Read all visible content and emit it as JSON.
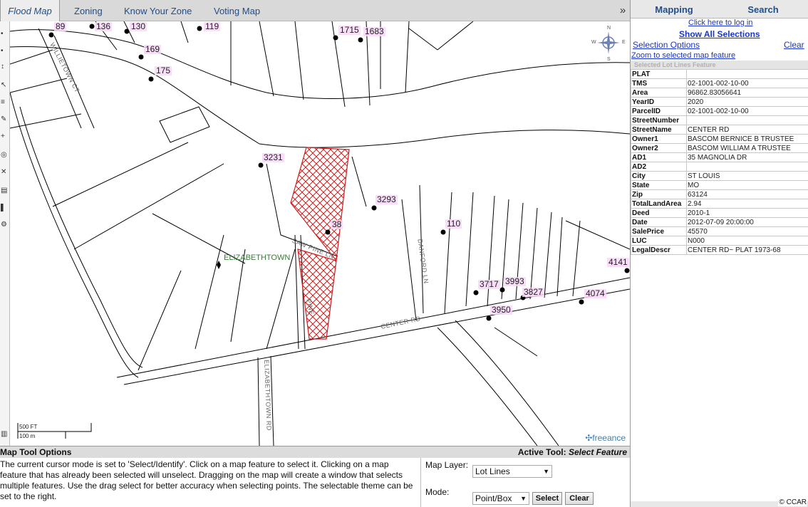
{
  "topbar": {
    "tabs": [
      {
        "label": "Flood Map",
        "active": true
      },
      {
        "label": "Zoning",
        "active": false
      },
      {
        "label": "Know Your Zone",
        "active": false
      },
      {
        "label": "Voting Map",
        "active": false
      }
    ],
    "collapse_glyph": "»"
  },
  "map": {
    "address_labels": [
      "89",
      "136",
      "130",
      "119",
      "1715",
      "1683",
      "169",
      "175",
      "3231",
      "3293",
      "38",
      "110",
      "4141",
      "3717",
      "3993",
      "3827",
      "4074",
      "3950"
    ],
    "road_labels": [
      "WILLIETOWN CT",
      "SAW PINE LN",
      "DANFORD LN",
      "CENTER RD",
      "ELIZABETHTOWN RD",
      "PINE"
    ],
    "place_label": "ELIZABETHTOWN",
    "compass": {
      "n": "N",
      "s": "S",
      "e": "E",
      "w": "W"
    },
    "scale": {
      "imperial": "500 FT",
      "metric": "100 m"
    },
    "logo": "freeance",
    "selection_color": "#cc1f1f"
  },
  "options": {
    "title": "Map Tool Options",
    "active_tool_prefix": "Active Tool:",
    "active_tool_name": "Select Feature",
    "description": "The current cursor mode is set to 'Select/Identify'. Click on a map feature to select it. Clicking on a map feature that has already been selected will unselect. Dragging on the map will create a window that selects multiple features. Use the drag select for better accuracy when selecting points. The selectable theme can be set to the right.",
    "map_layer_label": "Map Layer:",
    "map_layer_value": "Lot Lines",
    "mode_label": "Mode:",
    "mode_value": "Point/Box",
    "select_button": "Select",
    "clear_button": "Clear"
  },
  "panel": {
    "tabs": [
      "Mapping",
      "Search"
    ],
    "login_link": "Click here to log in",
    "show_all_link": "Show All Selections",
    "selection_options_link": "Selection Options",
    "clear_link": "Clear",
    "zoom_link": "Zoom to selected map feature",
    "feature_header": "Selected Lot Lines Feature",
    "attributes": [
      {
        "key": "PLAT",
        "value": ""
      },
      {
        "key": "TMS",
        "value": "02-1001-002-10-00"
      },
      {
        "key": "Area",
        "value": "96862.83056641"
      },
      {
        "key": "YearID",
        "value": "2020"
      },
      {
        "key": "ParcelID",
        "value": "02-1001-002-10-00"
      },
      {
        "key": "StreetNumber",
        "value": ""
      },
      {
        "key": "StreetName",
        "value": "CENTER RD"
      },
      {
        "key": "Owner1",
        "value": "BASCOM BERNICE B TRUSTEE"
      },
      {
        "key": "Owner2",
        "value": "BASCOM WILLIAM A TRUSTEE"
      },
      {
        "key": "AD1",
        "value": "35 MAGNOLIA DR"
      },
      {
        "key": "AD2",
        "value": ""
      },
      {
        "key": "City",
        "value": "ST LOUIS"
      },
      {
        "key": "State",
        "value": "MO"
      },
      {
        "key": "Zip",
        "value": "63124"
      },
      {
        "key": "TotalLandArea",
        "value": "2.94"
      },
      {
        "key": "Deed",
        "value": "2010-1"
      },
      {
        "key": "Date",
        "value": "2012-07-09 20:00:00"
      },
      {
        "key": "SalePrice",
        "value": "45570"
      },
      {
        "key": "LUC",
        "value": "N000"
      },
      {
        "key": "LegalDescr",
        "value": "CENTER RD~ PLAT 1973-68"
      }
    ],
    "copyright": "© CCAR"
  }
}
